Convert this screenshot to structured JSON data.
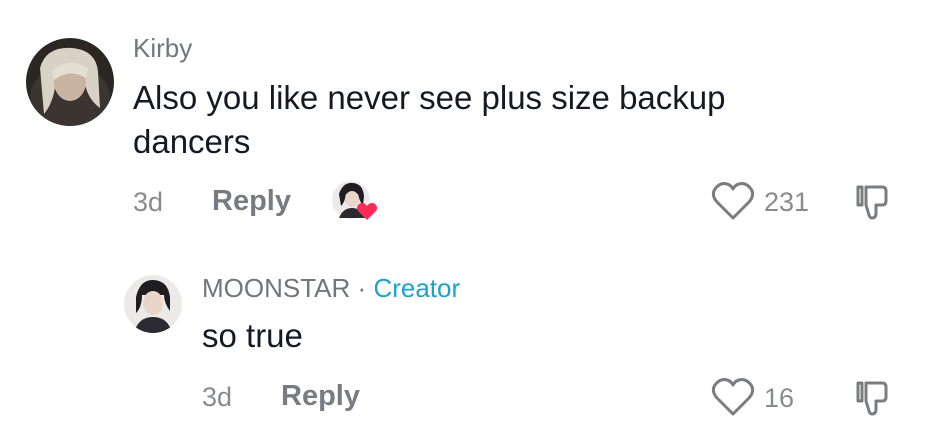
{
  "comments": [
    {
      "username": "Kirby",
      "text": "Also you like never see plus size backup dancers",
      "time": "3d",
      "reply_label": "Reply",
      "likes": "231"
    }
  ],
  "reply": {
    "username": "MOONSTAR",
    "separator": "·",
    "badge": "Creator",
    "text": "so true",
    "time": "3d",
    "reply_label": "Reply",
    "likes": "16"
  },
  "colors": {
    "creator_badge": "#1fa2c7",
    "liked_heart": "#fe2c55",
    "text_primary": "#161823",
    "text_secondary": "#73757c"
  },
  "icons": {
    "like": "heart-outline-icon",
    "dislike": "thumbs-down-icon",
    "creator_liked": "creator-liked-heart-icon"
  }
}
